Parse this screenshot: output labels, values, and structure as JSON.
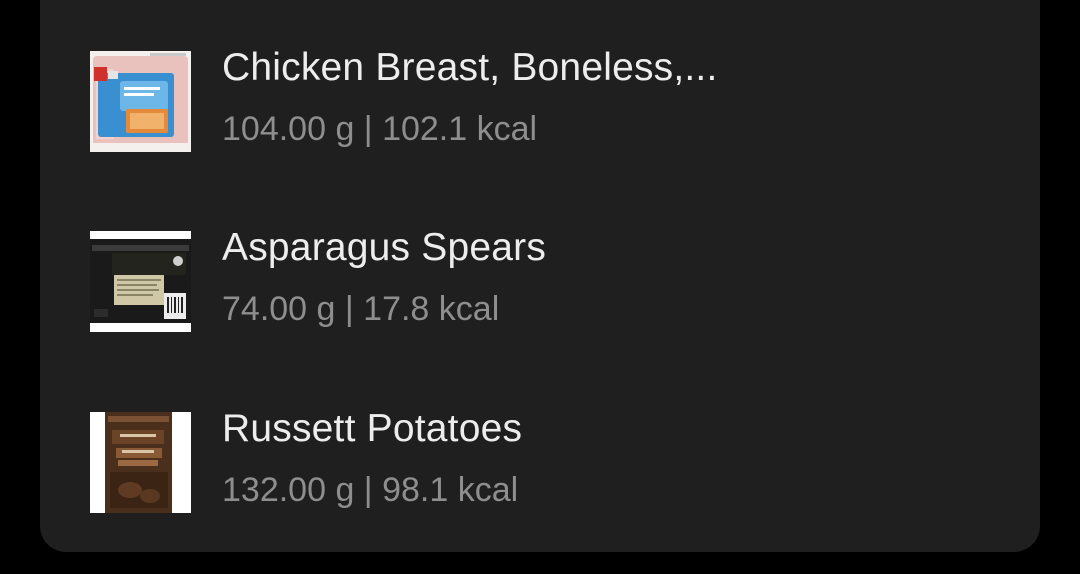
{
  "food_list": {
    "items": [
      {
        "name": "Chicken Breast, Boneless,...",
        "amount": "104.00 g",
        "separator": "|",
        "calories": "102.1 kcal",
        "detail": "104.00 g | 102.1 kcal",
        "thumbnail_icon": "chicken-package-thumbnail"
      },
      {
        "name": "Asparagus Spears",
        "amount": "74.00 g",
        "separator": "|",
        "calories": "17.8 kcal",
        "detail": "74.00 g | 17.8 kcal",
        "thumbnail_icon": "asparagus-package-thumbnail"
      },
      {
        "name": "Russett Potatoes",
        "amount": "132.00 g",
        "separator": "|",
        "calories": "98.1 kcal",
        "detail": "132.00 g | 98.1 kcal",
        "thumbnail_icon": "potato-bag-thumbnail"
      }
    ]
  },
  "colors": {
    "background": "#000000",
    "card": "#1f1f1f",
    "name_text": "#ededed",
    "detail_text": "#8e8e8e"
  }
}
